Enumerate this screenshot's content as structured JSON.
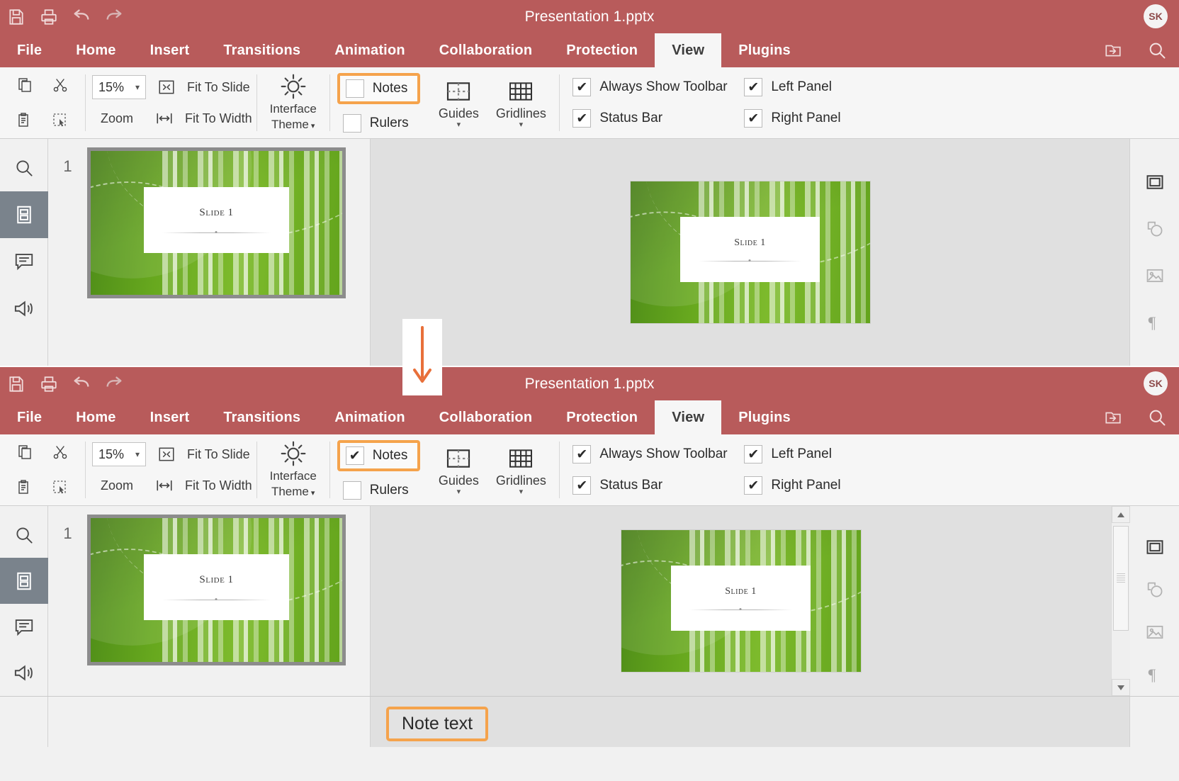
{
  "app": {
    "document_title": "Presentation 1.pptx",
    "avatar_initials": "SK",
    "accent_highlight_color": "#f5a34c",
    "titlebar_color": "#b85b5b"
  },
  "titlebar": {
    "icons": [
      {
        "name": "save-icon",
        "label": "Save"
      },
      {
        "name": "print-icon",
        "label": "Print"
      },
      {
        "name": "undo-icon",
        "label": "Undo"
      },
      {
        "name": "redo-icon",
        "label": "Redo"
      }
    ]
  },
  "tabs": [
    {
      "label": "File",
      "active": false
    },
    {
      "label": "Home",
      "active": false
    },
    {
      "label": "Insert",
      "active": false
    },
    {
      "label": "Transitions",
      "active": false
    },
    {
      "label": "Animation",
      "active": false
    },
    {
      "label": "Collaboration",
      "active": false
    },
    {
      "label": "Protection",
      "active": false
    },
    {
      "label": "View",
      "active": true
    },
    {
      "label": "Plugins",
      "active": false
    }
  ],
  "tabbar_right_icons": [
    {
      "name": "open-file-location-icon"
    },
    {
      "name": "search-icon"
    }
  ],
  "ribbon": {
    "clipboard": [
      {
        "name": "copy-icon"
      },
      {
        "name": "cut-icon"
      },
      {
        "name": "paste-icon"
      },
      {
        "name": "select-all-icon"
      }
    ],
    "zoom_value": "15%",
    "zoom_label": "Zoom",
    "fit_to_slide_label": "Fit To Slide",
    "fit_to_width_label": "Fit To Width",
    "interface_theme_label_line1": "Interface",
    "interface_theme_label_line2": "Theme",
    "notes_label": "Notes",
    "rulers_label": "Rulers",
    "guides_label": "Guides",
    "gridlines_label": "Gridlines",
    "always_show_toolbar_label": "Always Show Toolbar",
    "status_bar_label": "Status Bar",
    "left_panel_label": "Left Panel",
    "right_panel_label": "Right Panel",
    "checked_glyph": "✔"
  },
  "left_sidebar": [
    {
      "name": "search-icon",
      "active": false
    },
    {
      "name": "slides-icon",
      "active": true
    },
    {
      "name": "comments-icon",
      "active": false
    },
    {
      "name": "feedback-icon",
      "active": false
    }
  ],
  "right_sidebar": [
    {
      "name": "slide-settings-icon",
      "active": true
    },
    {
      "name": "shape-settings-icon",
      "active": false
    },
    {
      "name": "image-settings-icon",
      "active": false
    },
    {
      "name": "paragraph-settings-icon",
      "active": false
    }
  ],
  "slide": {
    "number": "1",
    "title_text": "Slide 1"
  },
  "panels": {
    "top": {
      "notes_checked": false,
      "rulers_checked": false,
      "always_show_toolbar_checked": true,
      "status_bar_checked": true,
      "left_panel_checked": true,
      "right_panel_checked": true,
      "notes_pane_visible": false
    },
    "bottom": {
      "notes_checked": true,
      "rulers_checked": false,
      "always_show_toolbar_checked": true,
      "status_bar_checked": true,
      "left_panel_checked": true,
      "right_panel_checked": true,
      "notes_pane_visible": true,
      "note_text": "Note text"
    }
  },
  "callout": {
    "arrow_direction": "down",
    "arrow_color": "#e8703a"
  }
}
